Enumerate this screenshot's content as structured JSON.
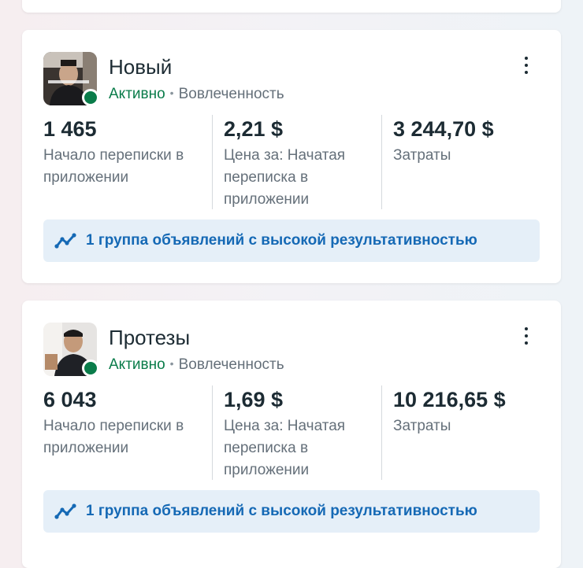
{
  "colors": {
    "active_status": "#0a7c4a",
    "link_blue": "#1569b5",
    "banner_bg": "#e5eff8",
    "muted_text": "#65707a"
  },
  "campaigns": [
    {
      "title": "Новый",
      "status": "Активно",
      "separator": "•",
      "objective": "Вовлеченность",
      "metrics": [
        {
          "value": "1 465",
          "label": "Начало переписки в приложении"
        },
        {
          "value": "2,21 $",
          "label": "Цена за: Начатая переписка в приложении"
        },
        {
          "value": "3 244,70 $",
          "label": "Затраты"
        }
      ],
      "banner": {
        "icon": "trend-up-icon",
        "text": "1 группа объявлений с высокой результативностью"
      }
    },
    {
      "title": "Протезы",
      "status": "Активно",
      "separator": "•",
      "objective": "Вовлеченность",
      "metrics": [
        {
          "value": "6 043",
          "label": "Начало переписки в приложении"
        },
        {
          "value": "1,69 $",
          "label": "Цена за: Начатая переписка в приложении"
        },
        {
          "value": "10 216,65 $",
          "label": "Затраты"
        }
      ],
      "banner": {
        "icon": "trend-up-icon",
        "text": "1 группа объявлений с высокой результативностью"
      }
    }
  ]
}
